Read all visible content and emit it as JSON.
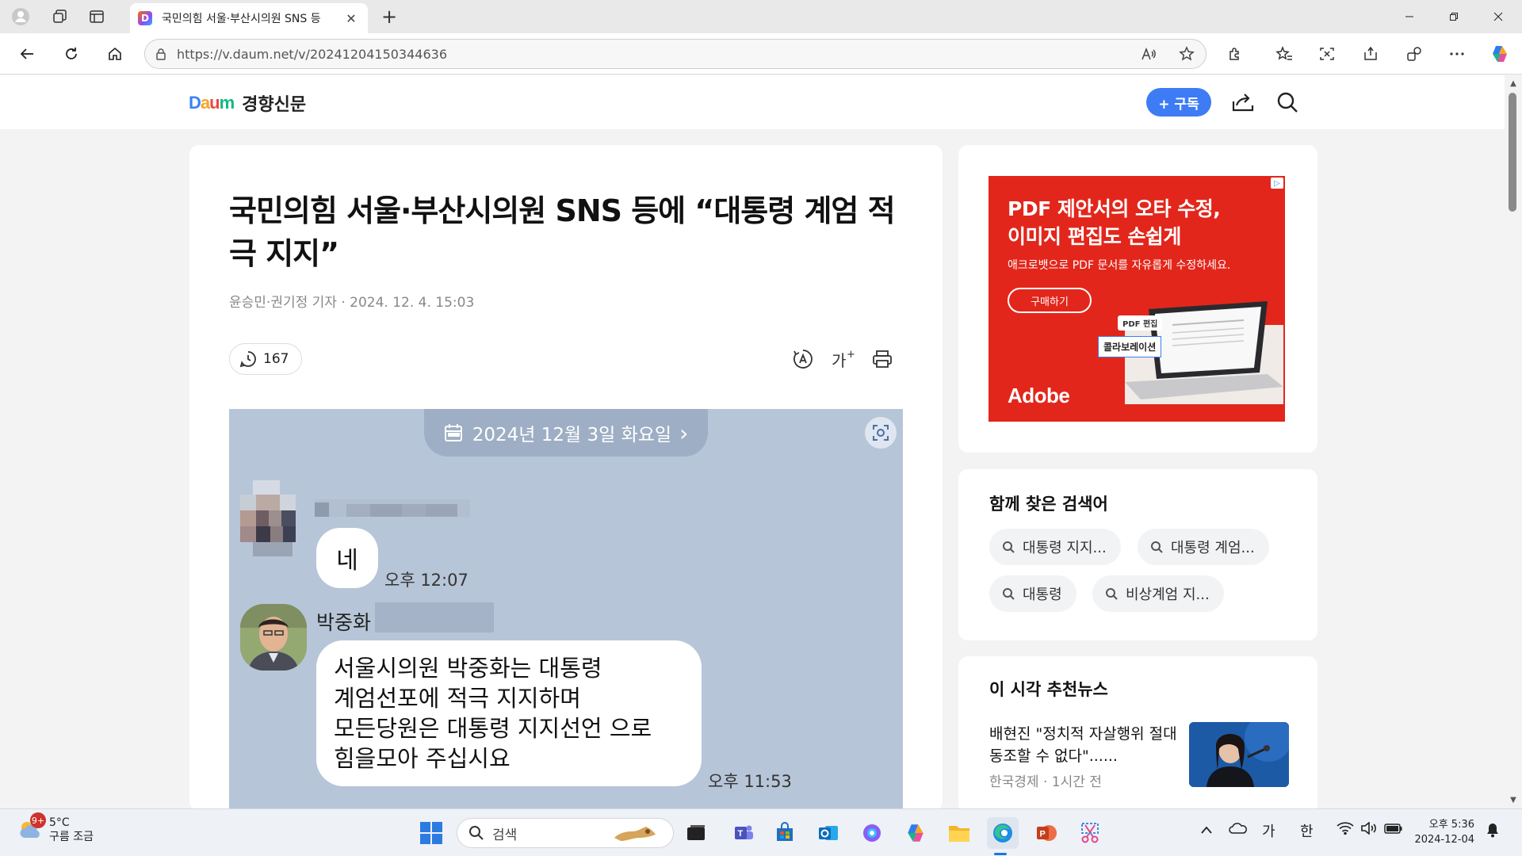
{
  "browser": {
    "tab_title": "국민의힘 서울·부산시의원 SNS 등",
    "favicon_letter": "D",
    "url": "https://v.daum.net/v/20241204150344636"
  },
  "site": {
    "logo_text": "Daum",
    "paper": "경향신문",
    "subscribe_label": "+ 구독"
  },
  "article": {
    "headline": "국민의힘 서울·부산시의원 SNS 등에 “대통령 계엄 적극 지지”",
    "byline": "윤승민·권기정 기자 · 2024. 12. 4. 15:03",
    "comment_count": "167",
    "image": {
      "date_pill": "2024년 12월 3일 화요일",
      "chevron": "›",
      "msg1": "네",
      "msg1_time": "오후 12:07",
      "sender": "박중화",
      "msg2_lines": [
        "서울시의원 박중화는 대통령",
        "계엄선포에 적극 지지하며",
        "모든당원은 대통령 지지선언 으로",
        "힘을모아 주십시요"
      ],
      "msg2_time": "오후 11:53"
    }
  },
  "ad": {
    "headline_1": "PDF 제안서의 오타 수정,",
    "headline_2": "이미지 편집도 손쉽게",
    "sub": "애크로뱃으로 PDF 문서를 자유롭게 수정하세요.",
    "button": "구매하기",
    "tag_pdf": "PDF 편집",
    "tag_collab": "콜라보레이션",
    "brand": "Adobe",
    "accent": "#e3261b"
  },
  "related": {
    "title": "함께 찾은 검색어",
    "chips": [
      "대통령 지지...",
      "대통령 계엄...",
      "대통령",
      "비상계엄 지..."
    ]
  },
  "news": {
    "title": "이 시각 추천뉴스",
    "item_title": "배현진 \"정치적 자살행위 절대 동조할 수 없다\"......",
    "item_source": "한국경제 · 1시간 전"
  },
  "taskbar": {
    "weather_temp": "5°C",
    "weather_desc": "구름 조금",
    "weather_badge": "9+",
    "search_placeholder": "검색",
    "ime_1": "가",
    "ime_2": "한",
    "time": "오후 5:36",
    "date": "2024-12-04"
  },
  "colors": {
    "accent": "#3d7cf5",
    "chat_bg": "#b7c5d8"
  }
}
